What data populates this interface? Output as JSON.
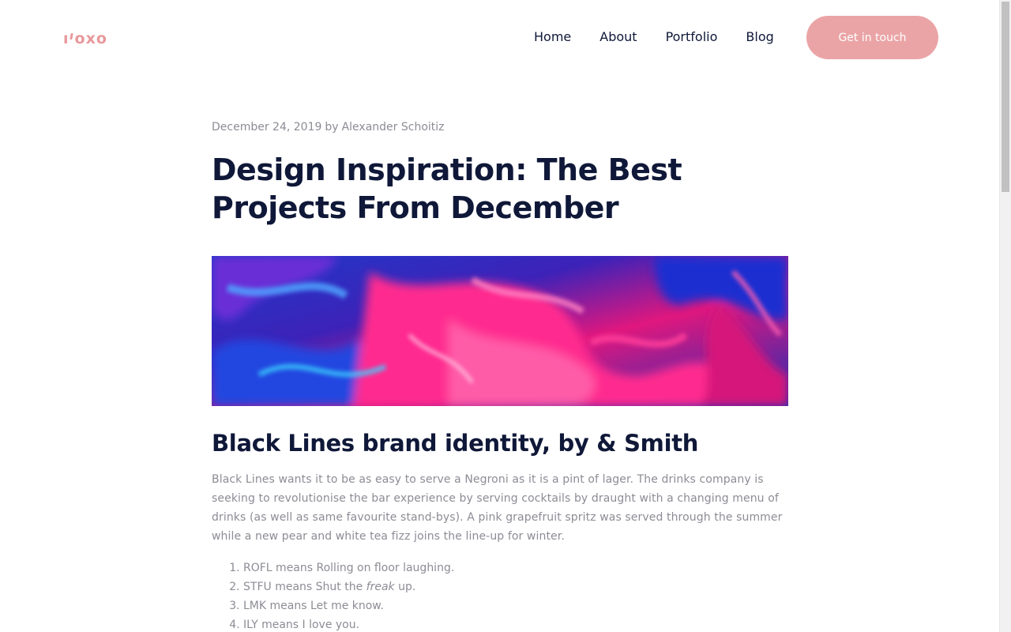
{
  "header": {
    "logo_text": "roxo",
    "nav": [
      "Home",
      "About",
      "Portfolio",
      "Blog"
    ],
    "cta_label": "Get in touch"
  },
  "article": {
    "date": "December 24, 2019",
    "by": "by",
    "author": "Alexander Schoitiz",
    "title": "Design Inspiration: The Best Projects From December",
    "subheading": "Black Lines brand identity, by & Smith",
    "paragraph": "Black Lines wants it to be as easy to serve a Negroni as it is a pint of lager. The drinks company is seeking to revolutionise the bar experience by serving cocktails by draught with a changing menu of drinks (as well as same favourite stand-bys). A pink grapefruit spritz was served through the summer while a new pear and white tea fizz joins the line-up for winter.",
    "list": [
      {
        "before": "ROFL means Rolling on floor laughing.",
        "em": "",
        "after": ""
      },
      {
        "before": "STFU means Shut the ",
        "em": "freak",
        "after": " up."
      },
      {
        "before": "LMK means Let me know.",
        "em": "",
        "after": ""
      },
      {
        "before": "ILY means I love you.",
        "em": "",
        "after": ""
      }
    ]
  },
  "colors": {
    "brand_pink": "#e8989a",
    "cta_bg": "#eba4a6",
    "heading": "#0f1838",
    "muted_text": "#8c8c95"
  }
}
